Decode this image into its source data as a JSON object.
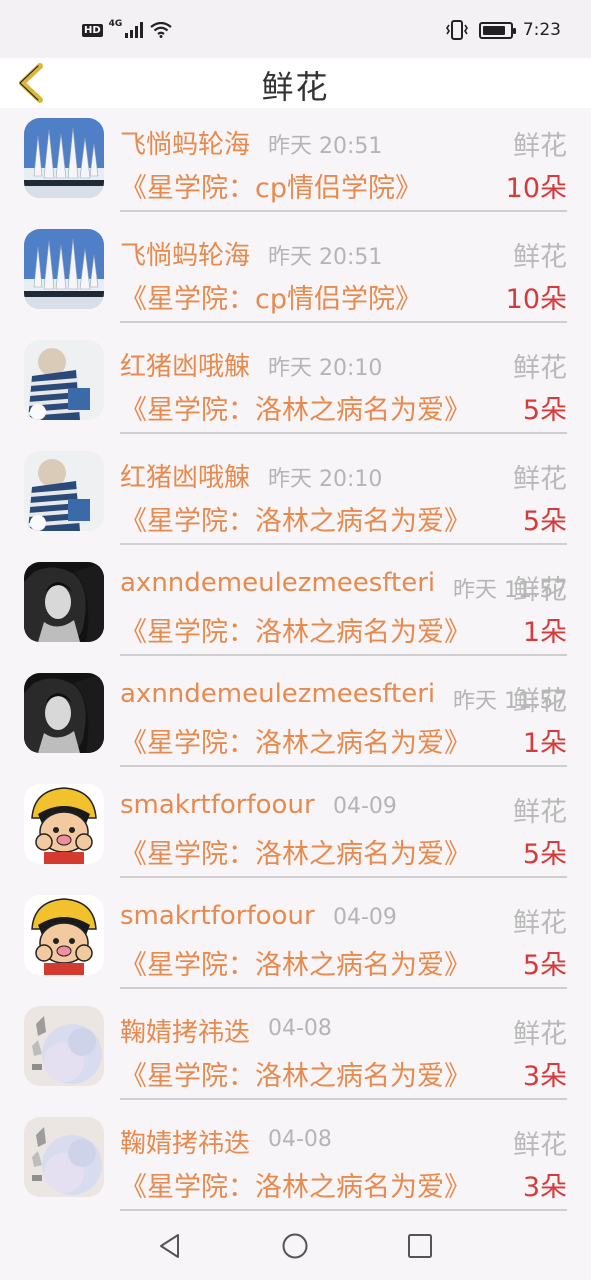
{
  "status_bar": {
    "network_label": "4G",
    "time": "7:23",
    "icons": [
      "hd-icon",
      "signal-icon",
      "wifi-icon",
      "vibrate-icon",
      "battery-icon"
    ]
  },
  "header": {
    "title": "鲜花",
    "back_icon": "chevron-left-icon",
    "accent_color": "#d9b53a"
  },
  "colors": {
    "username": "#e88a4e",
    "time": "#b5b5b5",
    "gift": "#b9b9b9",
    "quantity": "#d63b3b"
  },
  "records": [
    {
      "username": "飞惝蚂轮海",
      "time": "昨天 20:51",
      "gift": "鲜花",
      "book": "《星学院：cp情侣学院》",
      "quantity": "10朵",
      "avatar": "snowy-trees"
    },
    {
      "username": "飞惝蚂轮海",
      "time": "昨天 20:51",
      "gift": "鲜花",
      "book": "《星学院：cp情侣学院》",
      "quantity": "10朵",
      "avatar": "snowy-trees"
    },
    {
      "username": "红猪凼哦觫",
      "time": "昨天 20:10",
      "gift": "鲜花",
      "book": "《星学院：洛林之病名为爱》",
      "quantity": "5朵",
      "avatar": "striped-shirt"
    },
    {
      "username": "红猪凼哦觫",
      "time": "昨天 20:10",
      "gift": "鲜花",
      "book": "《星学院：洛林之病名为爱》",
      "quantity": "5朵",
      "avatar": "striped-shirt"
    },
    {
      "username": "axnndemeulezmeesfteri",
      "time": "昨天 11:57",
      "gift": "鲜花",
      "book": "《星学院：洛林之病名为爱》",
      "quantity": "1朵",
      "avatar": "dark-portrait"
    },
    {
      "username": "axnndemeulezmeesfteri",
      "time": "昨天 11:57",
      "gift": "鲜花",
      "book": "《星学院：洛林之病名为爱》",
      "quantity": "1朵",
      "avatar": "dark-portrait"
    },
    {
      "username": "smakrtforfoour",
      "time": "04-09",
      "gift": "鲜花",
      "book": "《星学院：洛林之病名为爱》",
      "quantity": "5朵",
      "avatar": "cartoon-boy"
    },
    {
      "username": "smakrtforfoour",
      "time": "04-09",
      "gift": "鲜花",
      "book": "《星学院：洛林之病名为爱》",
      "quantity": "5朵",
      "avatar": "cartoon-boy"
    },
    {
      "username": "鞠婧拷祎迭",
      "time": "04-08",
      "gift": "鲜花",
      "book": "《星学院：洛林之病名为爱》",
      "quantity": "3朵",
      "avatar": "pale-blossom"
    },
    {
      "username": "鞠婧拷祎迭",
      "time": "04-08",
      "gift": "鲜花",
      "book": "《星学院：洛林之病名为爱》",
      "quantity": "3朵",
      "avatar": "pale-blossom"
    }
  ],
  "nav_bar": {
    "icons": [
      "back-triangle-icon",
      "home-circle-icon",
      "recents-square-icon"
    ]
  }
}
